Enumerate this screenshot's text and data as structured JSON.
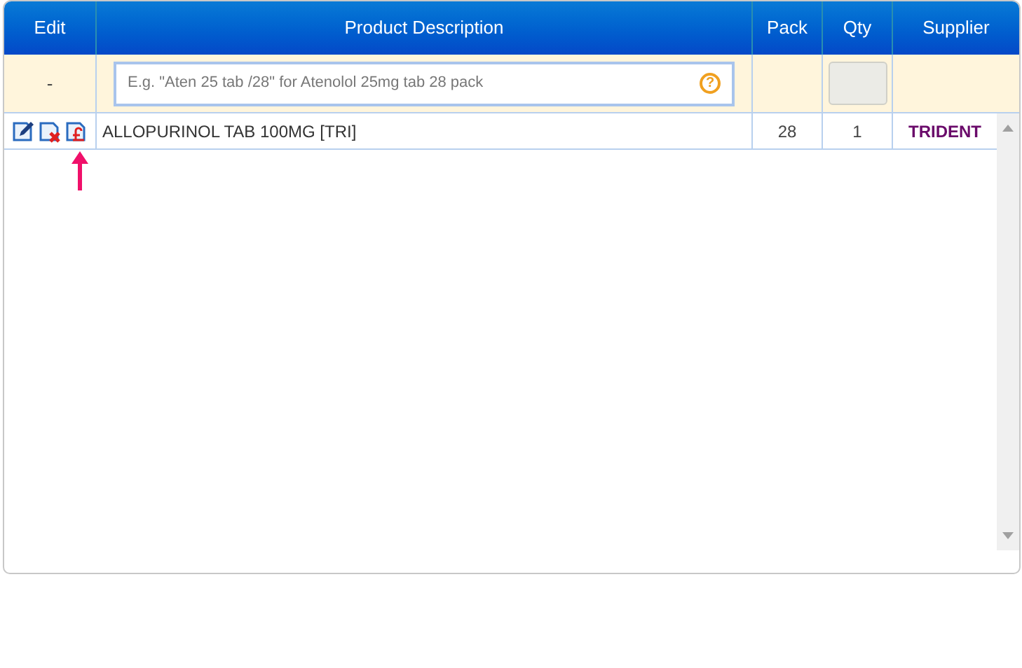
{
  "columns": [
    "Edit",
    "Product Description",
    "Pack",
    "Qty",
    "Supplier"
  ],
  "filter_row": {
    "edit": "-",
    "search": {
      "placeholder": "E.g. \"Aten 25 tab /28\" for Atenolol 25mg tab 28 pack"
    },
    "help_icon": "?"
  },
  "rows": [
    {
      "description": "ALLOPURINOL TAB 100MG [TRI]",
      "pack": "28",
      "qty": "1",
      "supplier": "TRIDENT",
      "annotated": true
    }
  ]
}
